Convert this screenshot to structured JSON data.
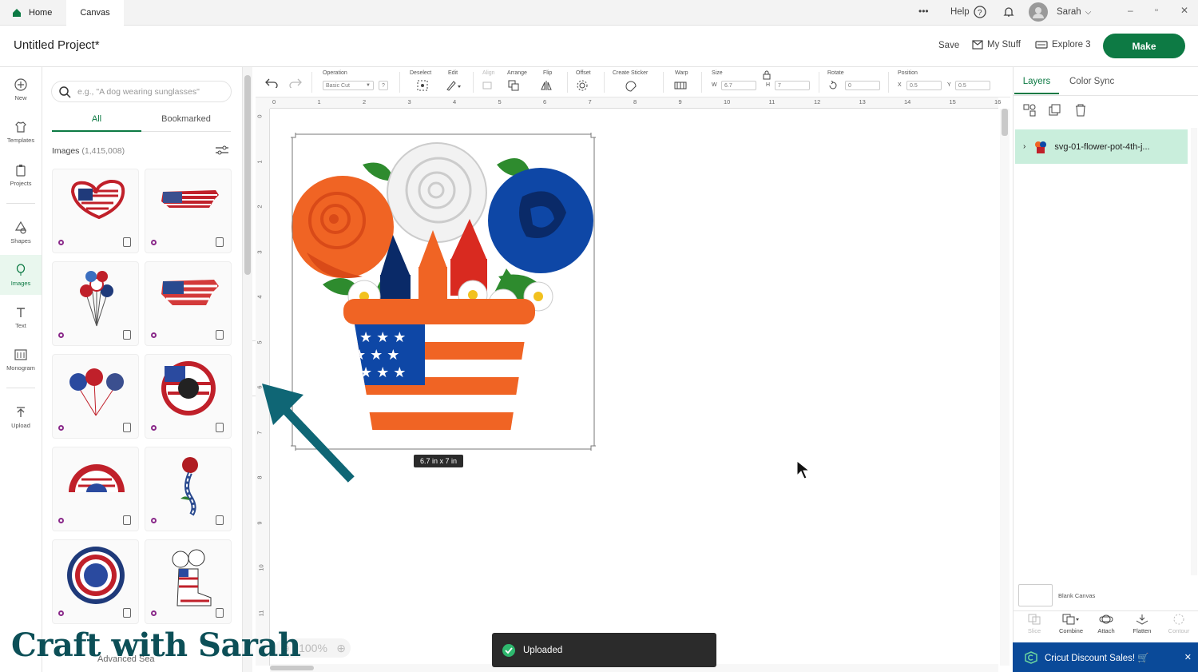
{
  "tabs": {
    "home": "Home",
    "canvas": "Canvas"
  },
  "topbar": {
    "more": "•••",
    "help": "Help",
    "user": "Sarah"
  },
  "header": {
    "title": "Untitled Project*",
    "save": "Save",
    "my_stuff": "My Stuff",
    "machine": "Explore 3",
    "make": "Make"
  },
  "nav": [
    "New",
    "Templates",
    "Projects",
    "Shapes",
    "Images",
    "Text",
    "Monogram",
    "Upload"
  ],
  "panel": {
    "search_placeholder": "e.g., \"A dog wearing sunglasses\"",
    "tab_all": "All",
    "tab_bookmarked": "Bookmarked",
    "images_label": "Images",
    "images_count": "(1,415,008)",
    "advanced": "Advanced Sea"
  },
  "toolbar": {
    "operation": "Operation",
    "operation_value": "Basic Cut",
    "deselect": "Deselect",
    "edit": "Edit",
    "align": "Align",
    "arrange": "Arrange",
    "flip": "Flip",
    "offset": "Offset",
    "create_sticker": "Create Sticker",
    "warp": "Warp",
    "size": "Size",
    "w_label": "W",
    "w_value": "6.7",
    "h_label": "H",
    "h_value": "7",
    "rotate": "Rotate",
    "rotate_value": "0",
    "position": "Position",
    "x_label": "X",
    "x_value": "0.5",
    "y_label": "Y",
    "y_value": "0.5"
  },
  "ruler_h": [
    "0",
    "1",
    "2",
    "3",
    "4",
    "5",
    "6",
    "7",
    "8",
    "9",
    "10",
    "11",
    "12",
    "13",
    "14",
    "15",
    "16"
  ],
  "ruler_v": [
    "0",
    "1",
    "2",
    "3",
    "4",
    "5",
    "6",
    "7",
    "8",
    "9",
    "10",
    "11"
  ],
  "canvas": {
    "size_label": "6.7 in x 7 in",
    "zoom": "100%"
  },
  "right": {
    "tab_layers": "Layers",
    "tab_color_sync": "Color Sync",
    "layer_name": "svg-01-flower-pot-4th-j...",
    "blank_canvas": "Blank Canvas",
    "slice": "Slice",
    "combine": "Combine",
    "attach": "Attach",
    "flatten": "Flatten",
    "contour": "Contour"
  },
  "toast": "Uploaded",
  "promo": "Cricut Discount Sales! 🛒",
  "watermark": "Craft with Sarah",
  "colors": {
    "brand_green": "#0d7a44",
    "selected_layer": "#c9eedc",
    "arrow": "#0f6675",
    "promo": "#0a4a99"
  }
}
